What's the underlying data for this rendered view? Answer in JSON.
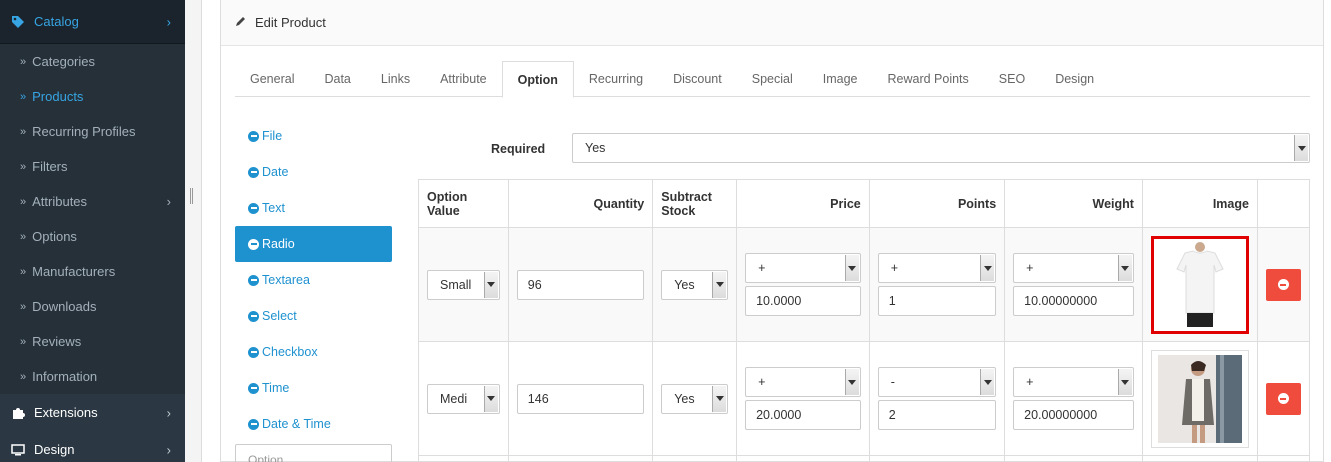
{
  "sidebar": {
    "catalog": "Catalog",
    "items": [
      {
        "label": "Categories"
      },
      {
        "label": "Products"
      },
      {
        "label": "Recurring Profiles"
      },
      {
        "label": "Filters"
      },
      {
        "label": "Attributes"
      },
      {
        "label": "Options"
      },
      {
        "label": "Manufacturers"
      },
      {
        "label": "Downloads"
      },
      {
        "label": "Reviews"
      },
      {
        "label": "Information"
      }
    ],
    "extensions": "Extensions",
    "design": "Design",
    "arrow": "»",
    "chevron": "›"
  },
  "panel": {
    "title": "Edit Product"
  },
  "tabs": [
    "General",
    "Data",
    "Links",
    "Attribute",
    "Option",
    "Recurring",
    "Discount",
    "Special",
    "Image",
    "Reward Points",
    "SEO",
    "Design"
  ],
  "options": [
    "File",
    "Date",
    "Text",
    "Radio",
    "Textarea",
    "Select",
    "Checkbox",
    "Time",
    "Date & Time"
  ],
  "option_input_placeholder": "Option",
  "required": {
    "label": "Required",
    "value": "Yes"
  },
  "table": {
    "headers": [
      "Option Value",
      "Quantity",
      "Subtract Stock",
      "Price",
      "Points",
      "Weight",
      "Image"
    ],
    "rows": [
      {
        "option_value": "Small",
        "quantity": "96",
        "subtract": "Yes",
        "price_prefix": "+",
        "price": "10.0000",
        "points_prefix": "+",
        "points": "1",
        "weight_prefix": "+",
        "weight": "10.00000000"
      },
      {
        "option_value": "Medi",
        "quantity": "146",
        "subtract": "Yes",
        "price_prefix": "+",
        "price": "20.0000",
        "points_prefix": "-",
        "points": "2",
        "weight_prefix": "+",
        "weight": "20.00000000"
      }
    ]
  },
  "colors": {
    "accent": "#1e91cf",
    "danger": "#f04c3e",
    "highlight": "#e10000",
    "sidebar": "#2b3843"
  }
}
